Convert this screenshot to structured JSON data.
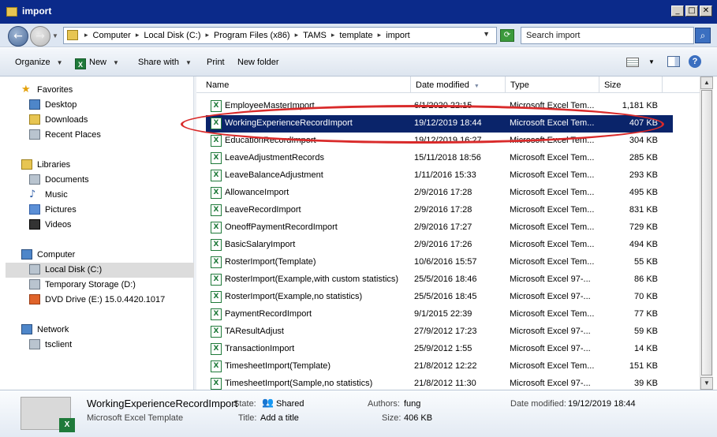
{
  "window": {
    "title": "import"
  },
  "address": {
    "crumbs": [
      "Computer",
      "Local Disk (C:)",
      "Program Files (x86)",
      "TAMS",
      "template",
      "import"
    ],
    "search_placeholder": "Search import"
  },
  "toolbar": {
    "organize": "Organize",
    "new": "New",
    "share_with": "Share with",
    "print": "Print",
    "new_folder": "New folder"
  },
  "nav": {
    "favorites": "Favorites",
    "desktop": "Desktop",
    "downloads": "Downloads",
    "recent_places": "Recent Places",
    "libraries": "Libraries",
    "documents": "Documents",
    "music": "Music",
    "pictures": "Pictures",
    "videos": "Videos",
    "computer": "Computer",
    "local_disk": "Local Disk (C:)",
    "temp_storage": "Temporary Storage (D:)",
    "dvd": "DVD Drive (E:) 15.0.4420.1017",
    "network": "Network",
    "tsclient": "tsclient"
  },
  "columns": {
    "name": "Name",
    "date": "Date modified",
    "type": "Type",
    "size": "Size"
  },
  "files": [
    {
      "name": "EmployeeMasterImport",
      "date": "6/1/2020 22:15",
      "type": "Microsoft Excel Tem...",
      "size": "1,181 KB"
    },
    {
      "name": "WorkingExperienceRecordImport",
      "date": "19/12/2019 18:44",
      "type": "Microsoft Excel Tem...",
      "size": "407 KB"
    },
    {
      "name": "EducationRecordImport",
      "date": "19/12/2019 16:27",
      "type": "Microsoft Excel Tem...",
      "size": "304 KB"
    },
    {
      "name": "LeaveAdjustmentRecords",
      "date": "15/11/2018 18:56",
      "type": "Microsoft Excel Tem...",
      "size": "285 KB"
    },
    {
      "name": "LeaveBalanceAdjustment",
      "date": "1/11/2016 15:33",
      "type": "Microsoft Excel Tem...",
      "size": "293 KB"
    },
    {
      "name": "AllowanceImport",
      "date": "2/9/2016 17:28",
      "type": "Microsoft Excel Tem...",
      "size": "495 KB"
    },
    {
      "name": "LeaveRecordImport",
      "date": "2/9/2016 17:28",
      "type": "Microsoft Excel Tem...",
      "size": "831 KB"
    },
    {
      "name": "OneoffPaymentRecordImport",
      "date": "2/9/2016 17:27",
      "type": "Microsoft Excel Tem...",
      "size": "729 KB"
    },
    {
      "name": "BasicSalaryImport",
      "date": "2/9/2016 17:26",
      "type": "Microsoft Excel Tem...",
      "size": "494 KB"
    },
    {
      "name": "RosterImport(Template)",
      "date": "10/6/2016 15:57",
      "type": "Microsoft Excel Tem...",
      "size": "55 KB"
    },
    {
      "name": "RosterImport(Example,with custom statistics)",
      "date": "25/5/2016 18:46",
      "type": "Microsoft Excel 97-...",
      "size": "86 KB"
    },
    {
      "name": "RosterImport(Example,no statistics)",
      "date": "25/5/2016 18:45",
      "type": "Microsoft Excel 97-...",
      "size": "70 KB"
    },
    {
      "name": "PaymentRecordImport",
      "date": "9/1/2015 22:39",
      "type": "Microsoft Excel Tem...",
      "size": "77 KB"
    },
    {
      "name": "TAResultAdjust",
      "date": "27/9/2012 17:23",
      "type": "Microsoft Excel 97-...",
      "size": "59 KB"
    },
    {
      "name": "TransactionImport",
      "date": "25/9/2012 1:55",
      "type": "Microsoft Excel 97-...",
      "size": "14 KB"
    },
    {
      "name": "TimesheetImport(Template)",
      "date": "21/8/2012 12:22",
      "type": "Microsoft Excel Tem...",
      "size": "151 KB"
    },
    {
      "name": "TimesheetImport(Sample,no statistics)",
      "date": "21/8/2012 11:30",
      "type": "Microsoft Excel 97-...",
      "size": "39 KB"
    }
  ],
  "details": {
    "filename": "WorkingExperienceRecordImport",
    "filetype": "Microsoft Excel Template",
    "state_label": "State:",
    "state_value": "Shared",
    "title_label": "Title:",
    "title_value": "Add a title",
    "authors_label": "Authors:",
    "authors_value": "fung",
    "size_label": "Size:",
    "size_value": "406 KB",
    "date_label": "Date modified:",
    "date_value": "19/12/2019 18:44"
  }
}
